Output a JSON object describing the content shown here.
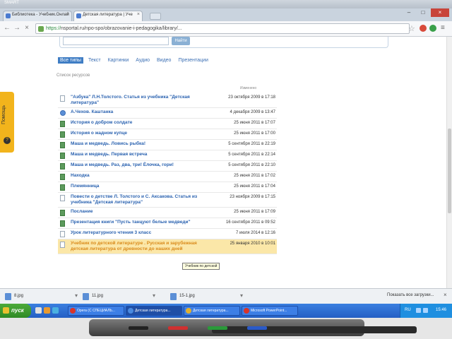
{
  "os": {
    "title": "SMART"
  },
  "tabs": [
    {
      "label": "Библиотека - Учебник.Онлай",
      "active": false
    },
    {
      "label": "Детская литература | Уче",
      "active": true
    },
    {
      "label": "",
      "active": false
    }
  ],
  "address": {
    "scheme": "https://",
    "rest": "nsportal.ru/npo-spo/obrazovanie-i-pedagogika/library/...",
    "back_icon": "arrow-left-icon",
    "forward_icon": "arrow-right-icon",
    "reload_icon": "reload-icon"
  },
  "search": {
    "placeholder": "",
    "button_label": "Найти"
  },
  "filters": [
    {
      "label": "Все типы",
      "active": true
    },
    {
      "label": "Текст",
      "active": false
    },
    {
      "label": "Картинки",
      "active": false
    },
    {
      "label": "Аудио",
      "active": false
    },
    {
      "label": "Видео",
      "active": false
    },
    {
      "label": "Презентации",
      "active": false
    }
  ],
  "section_label": "Список ресурсов",
  "column_header": "Изменено",
  "helper": {
    "label": "Помощь",
    "icon": "question-icon"
  },
  "rows": [
    {
      "title": "\"Азбука\" Л.Н.Толстого. Статья из учебника \"Детская литература\"",
      "date": "23 октября 2009 в 17:18",
      "icon": "doc",
      "highlight": false
    },
    {
      "title": "А.Чехов. Каштанка",
      "date": "4 декабря 2009 в 13:47",
      "icon": "info",
      "highlight": false
    },
    {
      "title": "История о добром солдате",
      "date": "25 июня 2011 в 17:07",
      "icon": "green",
      "highlight": false
    },
    {
      "title": "История о жадном купце",
      "date": "25 июня 2011 в 17:00",
      "icon": "green",
      "highlight": false
    },
    {
      "title": "Маша и медведь. Ловись рыбка!",
      "date": "5 сентября 2011 в 22:19",
      "icon": "green",
      "highlight": false
    },
    {
      "title": "Маша и медведь. Первая встреча",
      "date": "5 сентября 2011 в 22:14",
      "icon": "green",
      "highlight": false
    },
    {
      "title": "Маша и медведь. Раз, два, три! Ёлочка, гори!",
      "date": "5 сентября 2011 в 22:10",
      "icon": "green",
      "highlight": false
    },
    {
      "title": "Находка",
      "date": "25 июня 2011 в 17:02",
      "icon": "green",
      "highlight": false
    },
    {
      "title": "Племянница",
      "date": "25 июня 2011 в 17:04",
      "icon": "green",
      "highlight": false
    },
    {
      "title": "Повести о детстве Л. Толстого и С. Аксакова. Статья из учебника \"Детская литература\"",
      "date": "23 ноября 2009 в 17:15",
      "icon": "doc",
      "highlight": false
    },
    {
      "title": "Послание",
      "date": "25 июня 2011 в 17:09",
      "icon": "green",
      "highlight": false
    },
    {
      "title": "Презентация книги \"Пусть танцуют белые медведи\"",
      "date": "16 сентября 2011 в 09:52",
      "icon": "green",
      "highlight": false
    },
    {
      "title": "Урок литературного чтения 3 класс",
      "date": "7 июля 2014 в 12:16",
      "icon": "doc",
      "highlight": false
    },
    {
      "title": "Учебник по детской литературе . Русская и зарубежная детская литература от древности до наших дней",
      "date": "25 января 2010 в 10:01",
      "icon": "doc",
      "highlight": true
    }
  ],
  "tooltip": "Учебник по детской",
  "downloads": [
    {
      "label": "8.jpg"
    },
    {
      "label": "11.jpg"
    },
    {
      "label": "15-1.jpg"
    }
  ],
  "downloads_show_all": "Показать все загрузки...",
  "taskbar": {
    "start": "пуск",
    "tasks": [
      {
        "label": "Opera (С СПЕЦИАЛЬ...",
        "active": false,
        "color": "#d8342a"
      },
      {
        "label": "Детская литература...",
        "active": true,
        "color": "#4a8be0"
      },
      {
        "label": "Детская литература...",
        "active": false,
        "color": "#e0b030"
      },
      {
        "label": "Microsoft PowerPoint...",
        "active": false,
        "color": "#d8342a"
      }
    ],
    "lang": "RU",
    "clock": "15:46"
  },
  "colors": {
    "link": "#2a62b0",
    "highlight_bg": "#fbe7a8",
    "filter_active": "#3f7dc4",
    "helper": "#f2b41c"
  }
}
